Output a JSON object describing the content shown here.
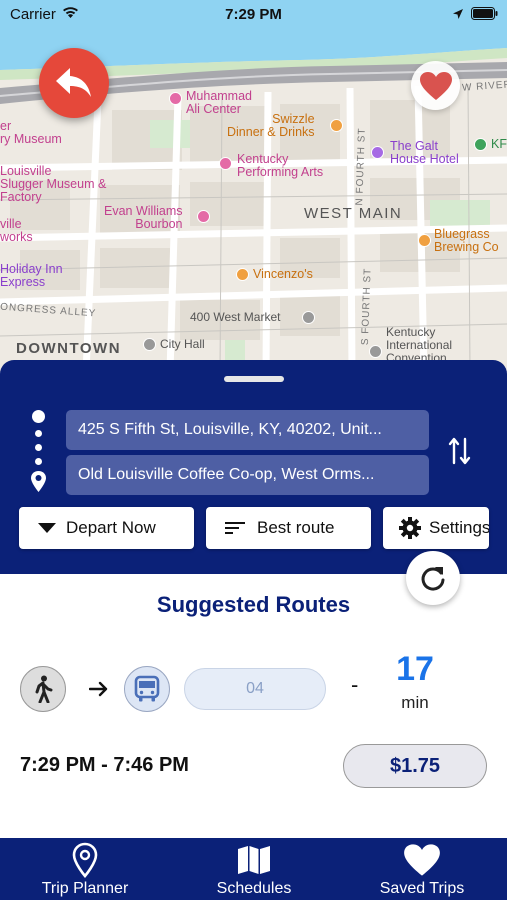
{
  "status_bar": {
    "carrier": "Carrier",
    "time": "7:29 PM"
  },
  "map": {
    "labels": {
      "muhammad": "Muhammad\nAli Center",
      "swizzle": "Swizzle\nDinner & Drinks",
      "galt": "The Galt\nHouse Hotel",
      "kfc": "KF",
      "museum": "er\nry Museum",
      "kentucky_pa": "Kentucky\nPerforming Arts",
      "slugger": "Louisville\nSlugger Museum &\nFactory",
      "evan": "Evan Williams\nBourbon",
      "ville": "ville\nworks",
      "bluegrass": "Bluegrass\nBrewing Co",
      "vincenzo": "Vincenzo's",
      "holiday": "Holiday Inn\nExpress",
      "market": "400 West Market",
      "kic": "Kentucky\nInternational\nConvention",
      "city_hall": "City Hall",
      "west_main": "WEST MAIN",
      "downtown": "DOWNTOWN",
      "congress_alley": "ONGRESS ALLEY",
      "fourth_st": "N FOURTH ST",
      "fourth_st2": "S FOURTH ST",
      "w_river": "W RIVER"
    }
  },
  "planner": {
    "origin": "425 S Fifth St, Louisville, KY, 40202, Unit...",
    "destination": "Old Louisville Coffee Co-op, West Orms...",
    "depart_label": "Depart Now",
    "route_label": "Best route",
    "settings_label": "Settings"
  },
  "results": {
    "title": "Suggested Routes",
    "route_number": "04",
    "separator": "-",
    "duration_value": "17",
    "duration_unit": "min",
    "time_range": "7:29 PM - 7:46 PM",
    "fare": "$1.75"
  },
  "tabs": [
    {
      "label": "Trip Planner",
      "icon": "location-pin-icon"
    },
    {
      "label": "Schedules",
      "icon": "map-icon"
    },
    {
      "label": "Saved Trips",
      "icon": "heart-icon"
    }
  ],
  "colors": {
    "primary": "#0b2178",
    "accent_blue": "#1a73e8",
    "back_button": "#e5483a",
    "favorite": "#d9534f",
    "water": "#8fd3f2"
  }
}
